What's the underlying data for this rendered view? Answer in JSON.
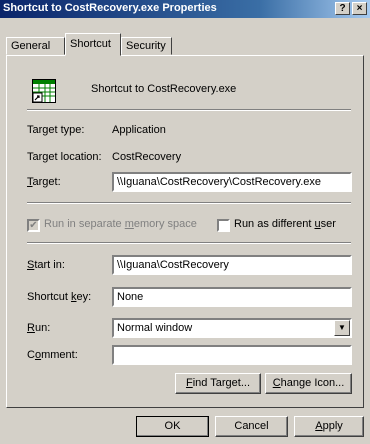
{
  "window": {
    "title": "Shortcut to CostRecovery.exe Properties",
    "help_btn": "?",
    "close_btn": "×"
  },
  "tabs": [
    {
      "label": "General"
    },
    {
      "label": "Shortcut"
    },
    {
      "label": "Security"
    }
  ],
  "header": {
    "name": "Shortcut to CostRecovery.exe",
    "icon_name": "spreadsheet-shortcut-icon"
  },
  "info": {
    "target_type_label": "Target type:",
    "target_type_value": "Application",
    "target_location_label": "Target location:",
    "target_location_value": "CostRecovery",
    "target_label_first": "T",
    "target_label_rest": "arget:",
    "target_value": "\\\\Iguana\\CostRecovery\\CostRecovery.exe"
  },
  "options": {
    "run_separate_pre": "Run in separate ",
    "run_separate_u": "m",
    "run_separate_post": "emory space",
    "run_separate_checked": true,
    "run_different_pre": "Run as different ",
    "run_different_u": "u",
    "run_different_post": "ser",
    "run_different_checked": false
  },
  "fields": {
    "start_in_label_first": "S",
    "start_in_label_rest": "tart in:",
    "start_in_value": "\\\\Iguana\\CostRecovery",
    "shortcut_key_pre": "Shortcut ",
    "shortcut_key_u": "k",
    "shortcut_key_post": "ey:",
    "shortcut_key_value": "None",
    "run_label_first": "R",
    "run_label_rest": "un:",
    "run_value": "Normal window",
    "comment_pre": "C",
    "comment_u": "o",
    "comment_post": "mment:",
    "comment_value": ""
  },
  "buttons": {
    "find_target_first": "F",
    "find_target_rest": "ind Target...",
    "change_icon_first": "C",
    "change_icon_rest": "hange Icon...",
    "ok": "OK",
    "cancel": "Cancel",
    "apply_first": "A",
    "apply_rest": "pply"
  }
}
